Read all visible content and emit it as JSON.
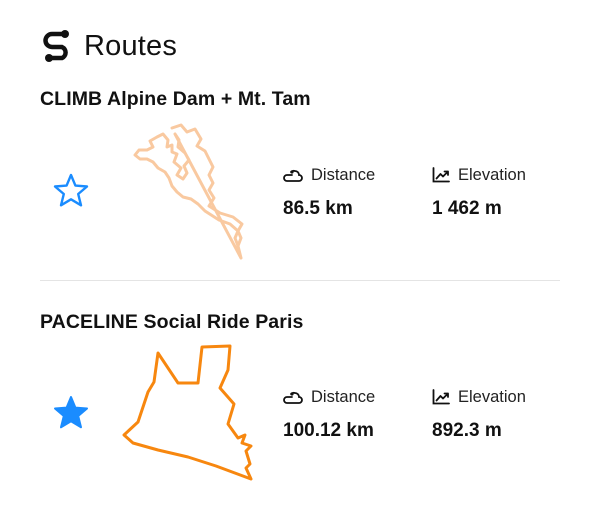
{
  "header": {
    "title": "Routes",
    "logo_icon": "route-logo-icon"
  },
  "routes": [
    {
      "name": "CLIMB Alpine Dam + Mt. Tam",
      "favorite": false,
      "star_color": "#1a8cff",
      "map_color": "#f9c9a0",
      "distance_label": "Distance",
      "distance_value": "86.5 km",
      "elevation_label": "Elevation",
      "elevation_value": "1 462 m"
    },
    {
      "name": "PACELINE Social Ride Paris",
      "favorite": true,
      "star_color": "#1a8cff",
      "map_color": "#f7870f",
      "distance_label": "Distance",
      "distance_value": "100.12 km",
      "elevation_label": "Elevation",
      "elevation_value": "892.3 m"
    }
  ]
}
